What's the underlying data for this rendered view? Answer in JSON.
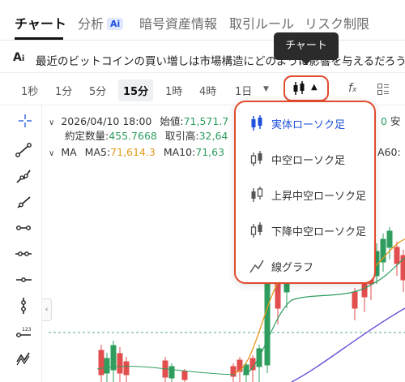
{
  "tabs": [
    {
      "label": "チャート",
      "active": true
    },
    {
      "label": "分析",
      "badge": "Ai"
    },
    {
      "label": "暗号資産情報"
    },
    {
      "label": "取引ルール"
    },
    {
      "label": "リスク制限"
    }
  ],
  "news": {
    "icon": "ai-icon",
    "text": "最近のビットコインの買い増しは市場構造にどのように影響を与えるだろうか"
  },
  "tooltip": "チャート",
  "timeframes": [
    "1秒",
    "1分",
    "5分",
    "15分",
    "1時",
    "4時",
    "1日"
  ],
  "active_timeframe": "15分",
  "toolbar_icons": [
    "crosshair-icon",
    "trend-line-icon",
    "multi-line-icon",
    "ray-icon",
    "horizontal-line-icon",
    "horizontal-segment-icon",
    "horizontal-ray-icon",
    "vertical-line-icon",
    "price-label-icon",
    "pattern-icon"
  ],
  "info": {
    "datetime": "2026/04/10 18:00",
    "open_label": "始値:",
    "open_value": "71,571.7",
    "volume_label": "約定数量:",
    "volume_value": "455.7668",
    "turnover_label": "取引高:",
    "turnover_value": "32,64",
    "ma_label": "MA",
    "ma5_label": "MA5:",
    "ma5_value": "71,614.3",
    "ma10_label": "MA10:",
    "ma10_value": "71,63",
    "ma60_label": "A60:",
    "right_value": "0",
    "right_label": "安"
  },
  "dropdown": {
    "items": [
      {
        "label": "実体ローソク足",
        "icon": "solid-candle-icon",
        "active": true
      },
      {
        "label": "中空ローソク足",
        "icon": "hollow-candle-icon"
      },
      {
        "label": "上昇中空ローソク足",
        "icon": "up-hollow-candle-icon"
      },
      {
        "label": "下降中空ローソク足",
        "icon": "down-hollow-candle-icon"
      },
      {
        "label": "線グラフ",
        "icon": "line-chart-icon"
      }
    ]
  },
  "colors": {
    "accent_red": "#e04a2d",
    "active_blue": "#1e50dc",
    "up_green": "#2e9d5e",
    "down_red": "#e24d4d",
    "ma_orange": "#e59a1d",
    "ma_purple": "#6b4fd8"
  }
}
